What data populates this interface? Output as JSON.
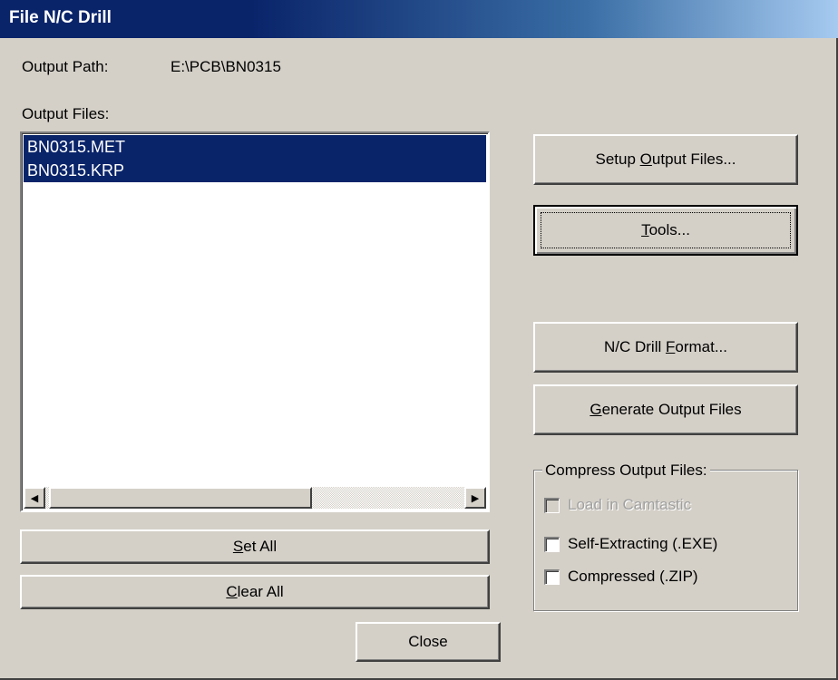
{
  "window": {
    "title": "File N/C Drill"
  },
  "output_path": {
    "label": "Output Path:",
    "value": "E:\\PCB\\BN0315"
  },
  "output_files": {
    "label": "Output Files:",
    "items": [
      "BN0315.MET",
      "BN0315.KRP"
    ]
  },
  "buttons": {
    "setup_output_files": {
      "pre": "Setup ",
      "key": "O",
      "post": "utput Files..."
    },
    "tools": {
      "pre": "",
      "key": "T",
      "post": "ools..."
    },
    "nc_drill_format": {
      "pre": "N/C Drill ",
      "key": "F",
      "post": "ormat..."
    },
    "generate_output_files": {
      "pre": "",
      "key": "G",
      "post": "enerate Output Files"
    },
    "set_all": {
      "pre": "",
      "key": "S",
      "post": "et All"
    },
    "clear_all": {
      "pre": "",
      "key": "C",
      "post": "lear All"
    },
    "close": {
      "label": "Close"
    }
  },
  "compress": {
    "title": "Compress Output Files:",
    "options": [
      {
        "label": "Load in Camtastic",
        "checked": false,
        "disabled": true
      },
      {
        "label": "Self-Extracting (.EXE)",
        "checked": false,
        "disabled": false
      },
      {
        "label": "Compressed (.ZIP)",
        "checked": false,
        "disabled": false
      }
    ]
  },
  "icons": {
    "scroll_left": "scroll-left-arrow",
    "scroll_right": "scroll-right-arrow"
  },
  "colors": {
    "titlebar": "#0a246a",
    "face": "#d4d0c8",
    "selection": "#0a246a"
  }
}
